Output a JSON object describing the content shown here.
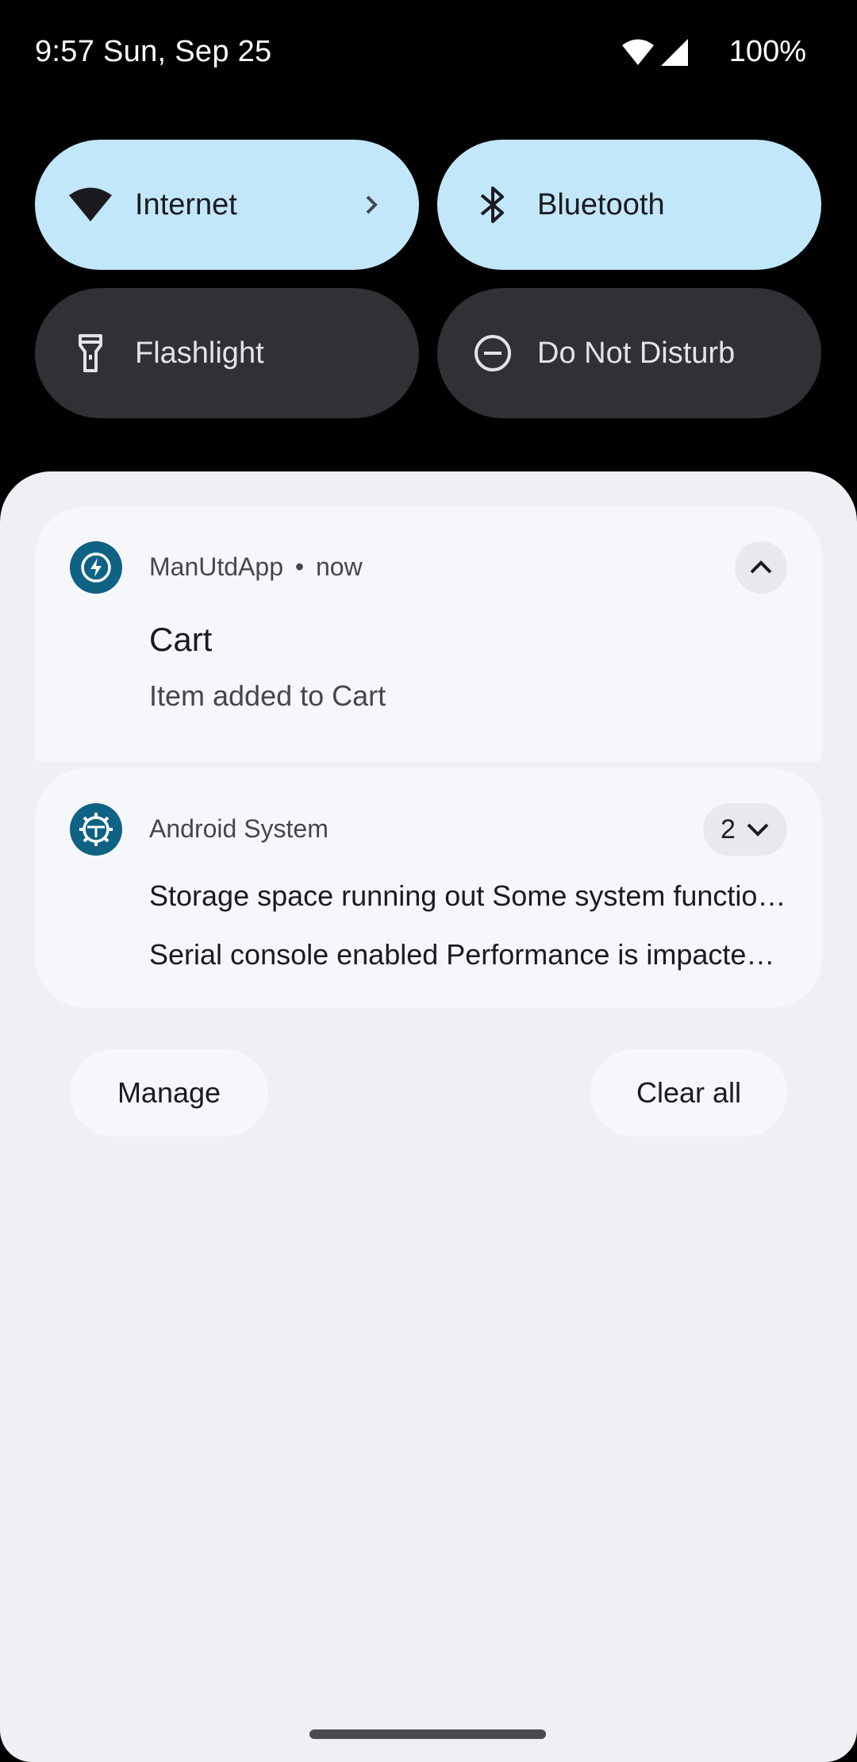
{
  "status_bar": {
    "time_date": "9:57 Sun, Sep 25",
    "battery": "100%",
    "icons": [
      "wifi-icon",
      "cell-signal-icon"
    ]
  },
  "quick_settings": {
    "tiles": [
      {
        "label": "Internet",
        "icon": "wifi-icon",
        "state": "on"
      },
      {
        "label": "Bluetooth",
        "icon": "bluetooth-icon",
        "state": "on"
      },
      {
        "label": "Flashlight",
        "icon": "flashlight-icon",
        "state": "off"
      },
      {
        "label": "Do Not Disturb",
        "icon": "do-not-disturb-icon",
        "state": "off"
      }
    ]
  },
  "notifications": [
    {
      "app": "ManUtdApp",
      "separator": "•",
      "time": "now",
      "title": "Cart",
      "text": "Item added to Cart",
      "icon": "bolt-icon",
      "expanded": true
    },
    {
      "app": "Android System",
      "count": "2",
      "icon": "android-system-icon",
      "lines": [
        "Storage space running out Some system functions may not work",
        "Serial console enabled Performance is impacted. To disable, check bootloader."
      ]
    }
  ],
  "actions": {
    "manage": "Manage",
    "clear_all": "Clear all"
  },
  "colors": {
    "tile_on": "#c2e7fb",
    "tile_off": "#2f3135",
    "app_icon": "#0e6283",
    "shade_bg": "#eff0f3"
  }
}
